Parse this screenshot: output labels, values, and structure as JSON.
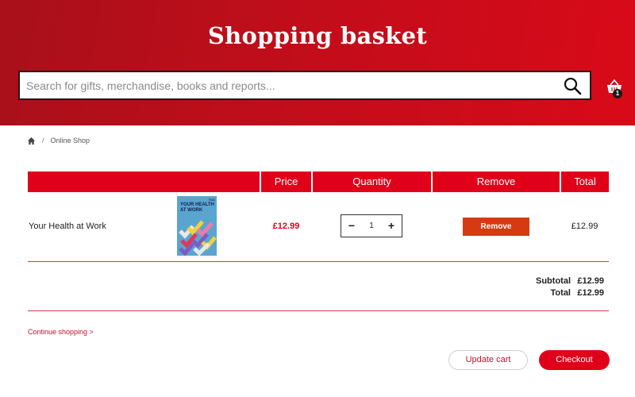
{
  "header": {
    "title": "Shopping basket",
    "search_placeholder": "Search for gifts, merchandise, books and reports...",
    "basket_count": "1"
  },
  "breadcrumb": {
    "home_icon": "home-icon",
    "items": [
      "Online Shop"
    ]
  },
  "table": {
    "columns": [
      "",
      "Price",
      "Quantity",
      "Remove",
      "Total"
    ],
    "rows": [
      {
        "title": "Your Health at Work",
        "cover_title": "YOUR HEALTH AT WORK",
        "cover_tag": "TUC",
        "price": "£12.99",
        "quantity": "1",
        "remove_label": "Remove",
        "total": "£12.99"
      }
    ]
  },
  "summary": {
    "subtotal_label": "Subtotal",
    "subtotal_value": "£12.99",
    "total_label": "Total",
    "total_value": "£12.99"
  },
  "actions": {
    "continue_label": "Continue shopping >",
    "update_label": "Update cart",
    "checkout_label": "Checkout"
  },
  "colors": {
    "brand_red": "#e1001a",
    "header_dark": "#a8101a",
    "remove_orange": "#d63a12"
  }
}
